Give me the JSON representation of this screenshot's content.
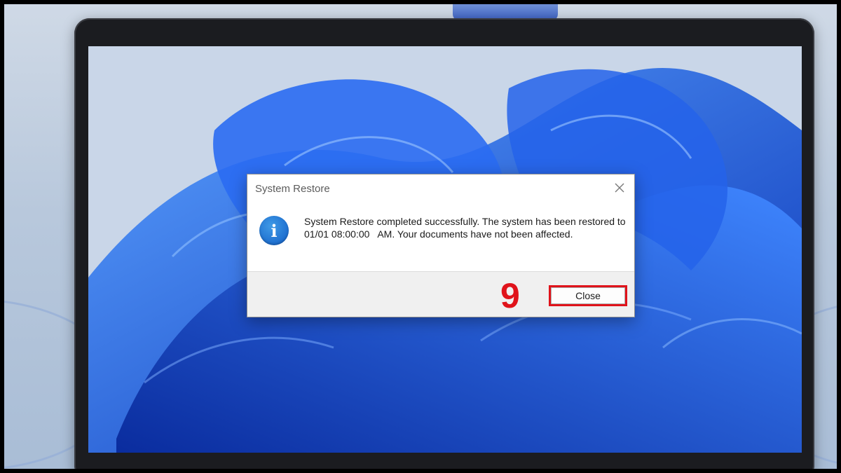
{
  "dialog": {
    "title": "System Restore",
    "message": "System Restore completed successfully. The system has been restored to      01/01 08:00:00   AM. Your documents have not been affected.",
    "close_button_label": "Close",
    "icon": "info-icon",
    "close_icon": "close-icon"
  },
  "annotation": {
    "step_number": "9",
    "highlight_color": "#e0131b"
  },
  "desktop": {
    "wallpaper": "windows-11-bloom",
    "accent": "#1f58e6"
  }
}
